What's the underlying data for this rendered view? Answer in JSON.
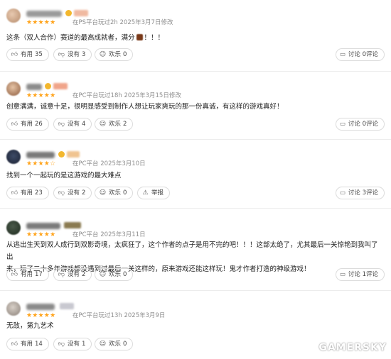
{
  "reviews": [
    {
      "stars": "★★★★★",
      "meta": "在PS平台玩过2h  2025年3月7日修改",
      "text": "这条（双人合作）赛道的最高成就者，满分",
      "text_suffix": "！！！",
      "likes": {
        "label": "有用",
        "count": "35"
      },
      "dislikes": {
        "label": "没有",
        "count": "3"
      },
      "funny": {
        "label": "欢乐",
        "count": "0"
      },
      "discuss": "讨论 0评论"
    },
    {
      "stars": "★★★★★",
      "meta": "在PC平台玩过18h  2025年3月15日修改",
      "text": "创意满满，诚意十足，很明显感受到制作人想让玩家爽玩的那一份真诚，有这样的游戏真好！",
      "likes": {
        "label": "有用",
        "count": "26"
      },
      "dislikes": {
        "label": "没有",
        "count": "4"
      },
      "funny": {
        "label": "欢乐",
        "count": "2"
      },
      "discuss": "讨论 0评论"
    },
    {
      "stars": "★★★★☆",
      "meta": "在PC平台  2025年3月10日",
      "text": "找到一个一起玩的是这游戏的最大难点",
      "likes": {
        "label": "有用",
        "count": "23"
      },
      "dislikes": {
        "label": "没有",
        "count": "2"
      },
      "funny": {
        "label": "欢乐",
        "count": "0"
      },
      "report": "举报",
      "discuss": "讨论 3评论"
    },
    {
      "stars": "★★★★★",
      "meta": "在PC平台  2025年3月11日",
      "text_line1": "从逃出生天到双人成行到双影奇境，太疯狂了，这个作者的点子是用不完的吧！！！这部太绝了，尤其最后一关惊艳到我叫了出",
      "text_line2": "来，玩了二十多年游戏都没遇到过最后一关这样的，原来游戏还能这样玩！鬼才作者打造的神级游戏！",
      "likes": {
        "label": "有用",
        "count": "17"
      },
      "dislikes": {
        "label": "没有",
        "count": "2"
      },
      "funny": {
        "label": "欢乐",
        "count": "0"
      },
      "discuss": "讨论 1评论"
    },
    {
      "stars": "★★★★★",
      "meta": "在PC平台玩过13h  2025年3月9日",
      "text": "无敌，第九艺术",
      "likes": {
        "label": "有用",
        "count": "14"
      },
      "dislikes": {
        "label": "没有",
        "count": "1"
      },
      "funny": {
        "label": "欢乐",
        "count": "0"
      },
      "discuss": "讨论 0评论"
    }
  ],
  "watermark": "GAMERSKY",
  "colors": {
    "star": "#ffa31a",
    "meta": "#8e8e8e",
    "border": "#dcdcdc"
  },
  "icons": {
    "like": "thumbs-up-icon",
    "dislike": "thumbs-down-icon",
    "funny": "smiley-icon",
    "report": "warning-icon",
    "discuss": "chat-bubble-icon"
  }
}
